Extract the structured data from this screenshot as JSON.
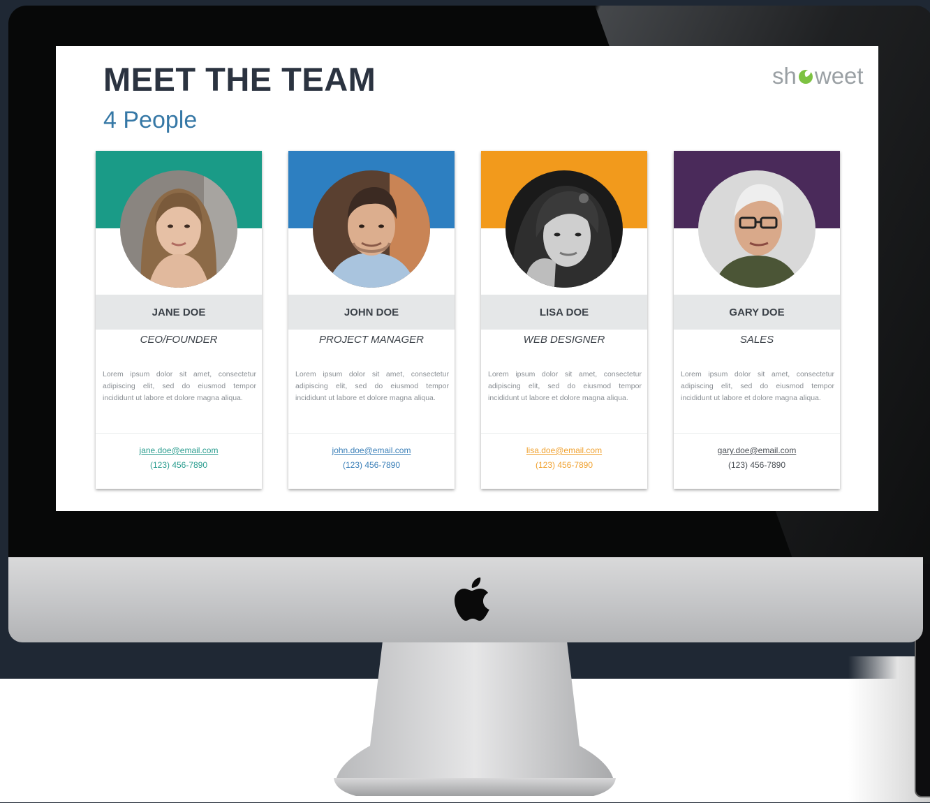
{
  "slide": {
    "title": "MEET THE TEAM",
    "subtitle": "4 People",
    "brand_prefix": "sh",
    "brand_suffix": "weet",
    "brand_icon": "leaf-icon"
  },
  "team": [
    {
      "name": "JANE DOE",
      "role": "CEO/FOUNDER",
      "bio": "Lorem ipsum dolor sit amet, consectetur adipiscing elit, sed do eiusmod tempor incididunt ut labore et dolore magna aliqua.",
      "email": "jane.doe@email.com",
      "phone": "(123) 456-7890",
      "accent": "#1a9b87",
      "contact_color": "#2a9d8f"
    },
    {
      "name": "JOHN DOE",
      "role": "PROJECT MANAGER",
      "bio": "Lorem ipsum dolor sit amet, consectetur adipiscing elit, sed do eiusmod tempor incididunt ut labore et dolore magna aliqua.",
      "email": "john.doe@email.com",
      "phone": "(123) 456-7890",
      "accent": "#2d7fc1",
      "contact_color": "#3a7fb8"
    },
    {
      "name": "LISA DOE",
      "role": "WEB DESIGNER",
      "bio": "Lorem ipsum dolor sit amet, consectetur adipiscing elit, sed do eiusmod tempor incididunt ut labore et dolore magna aliqua.",
      "email": "lisa.doe@email.com",
      "phone": "(123) 456-7890",
      "accent": "#f29a1c",
      "contact_color": "#f0a12e"
    },
    {
      "name": "GARY DOE",
      "role": "SALES",
      "bio": "Lorem ipsum dolor sit amet, consectetur adipiscing elit, sed do eiusmod tempor incididunt ut labore et dolore magna aliqua.",
      "email": "gary.doe@email.com",
      "phone": "(123) 456-7890",
      "accent": "#4a2a5a",
      "contact_color": "#4a4f55"
    }
  ],
  "device": {
    "logo_icon": "apple-logo-icon"
  }
}
